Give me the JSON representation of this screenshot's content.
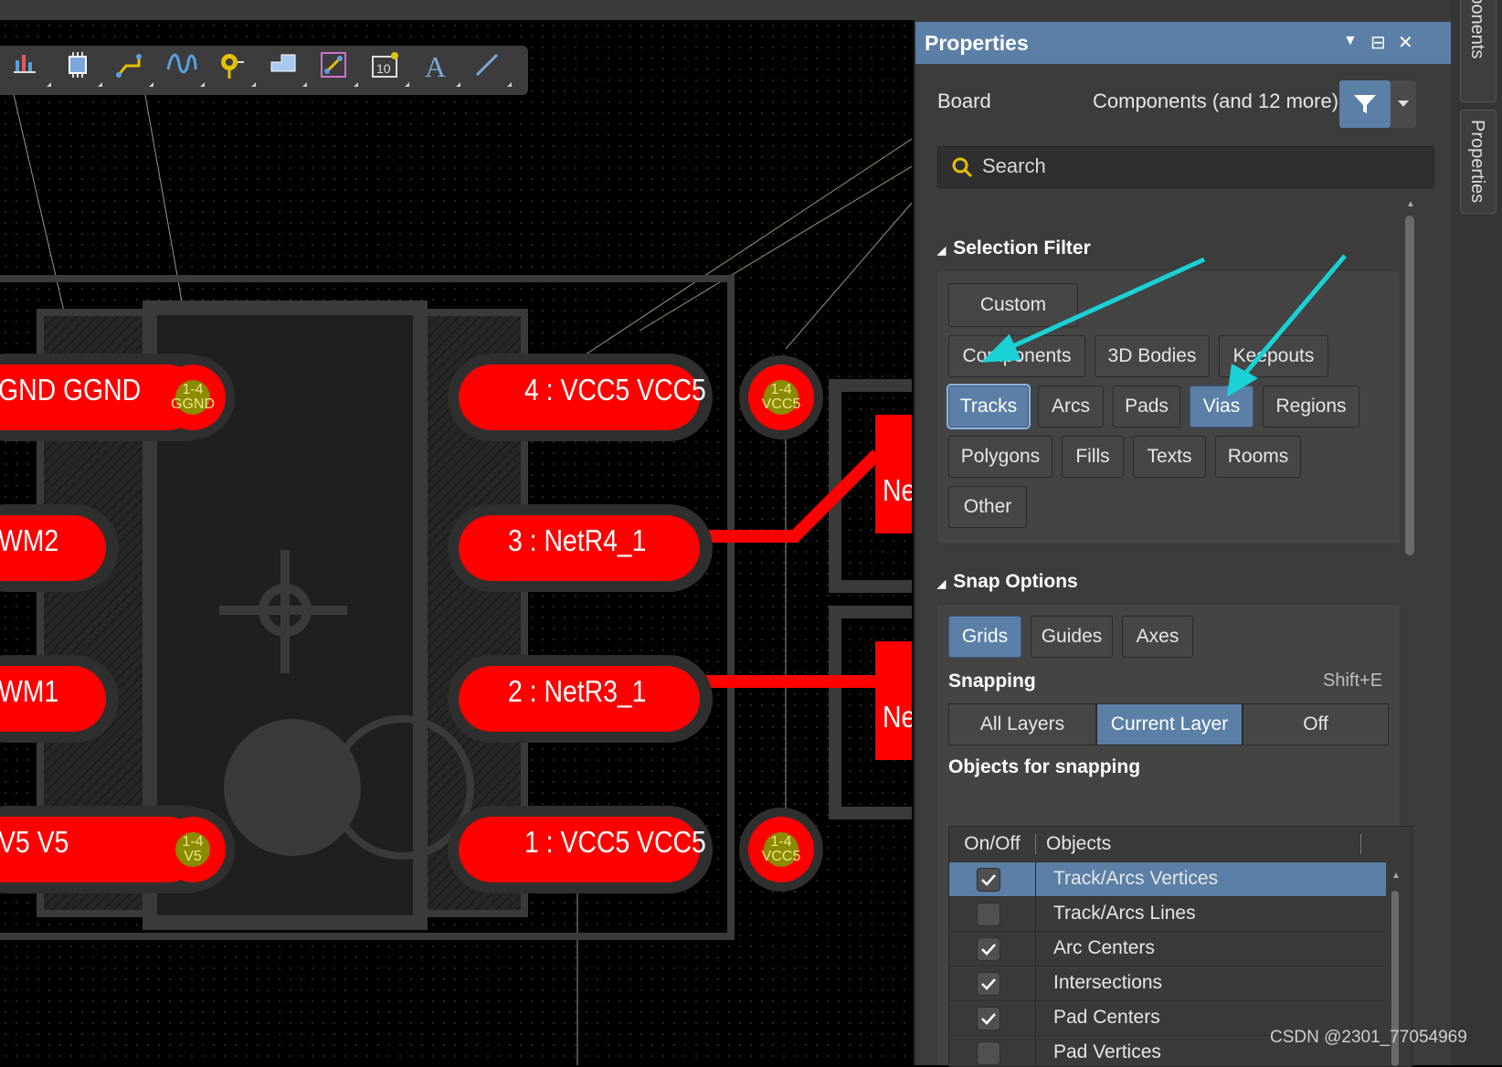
{
  "canvas": {
    "pads": [
      {
        "label": "GND  GGND",
        "pin": [
          "1-4",
          "GGND"
        ]
      },
      {
        "label": "4 : VCC5  VCC5",
        "pin": [
          "1-4",
          "VCC5"
        ]
      },
      {
        "label": "WM2"
      },
      {
        "label": "3 : NetR4_1"
      },
      {
        "label": "WM1"
      },
      {
        "label": "2 : NetR3_1"
      },
      {
        "label": "V5       V5",
        "pin": [
          "1-4",
          "V5"
        ]
      },
      {
        "label": "1 : VCC5  VCC5",
        "pin": [
          "1-4",
          "VCC5"
        ]
      },
      {
        "label": "Ne"
      },
      {
        "label": "Ne"
      }
    ],
    "pad_color": "#ff0000",
    "toolbar_icons": [
      "chart-icon",
      "chip-icon",
      "route-icon",
      "interactive-route-icon",
      "via-icon",
      "polygon-fill-icon",
      "dimension-icon",
      "array-paste-icon",
      "text-icon",
      "line-icon"
    ]
  },
  "panel": {
    "title": "Properties",
    "header_icons": [
      "▼",
      "⊟",
      "✕"
    ],
    "board_label": "Board",
    "board_value": "Components (and 12 more)",
    "search_placeholder": "Search",
    "selection_filter": {
      "title": "Selection Filter",
      "custom": "Custom",
      "buttons": [
        "Components",
        "3D Bodies",
        "Keepouts",
        "Tracks",
        "Arcs",
        "Pads",
        "Vias",
        "Regions",
        "Polygons",
        "Fills",
        "Texts",
        "Rooms",
        "Other"
      ],
      "active": [
        "Tracks",
        "Vias"
      ]
    },
    "snap_options": {
      "title": "Snap Options",
      "targets": [
        "Grids",
        "Guides",
        "Axes"
      ],
      "snapping_label": "Snapping",
      "snapping_shortcut": "Shift+E",
      "snapping_modes": [
        "All Layers",
        "Current Layer",
        "Off"
      ],
      "snapping_selected": "Current Layer",
      "objects_title": "Objects for snapping",
      "table_headers": [
        "On/Off",
        "Objects"
      ],
      "rows": [
        {
          "name": "Track/Arcs Vertices",
          "checked": true
        },
        {
          "name": "Track/Arcs Lines",
          "checked": false
        },
        {
          "name": "Arc Centers",
          "checked": true
        },
        {
          "name": "Intersections",
          "checked": true
        },
        {
          "name": "Pad Centers",
          "checked": true
        },
        {
          "name": "Pad Vertices",
          "checked": false
        }
      ]
    }
  },
  "side_tabs": [
    "Components",
    "Properties"
  ],
  "watermark": "CSDN @2301_77054969",
  "colors": {
    "accent": "#5b7fa6",
    "arrow": "#1ad1d6"
  }
}
